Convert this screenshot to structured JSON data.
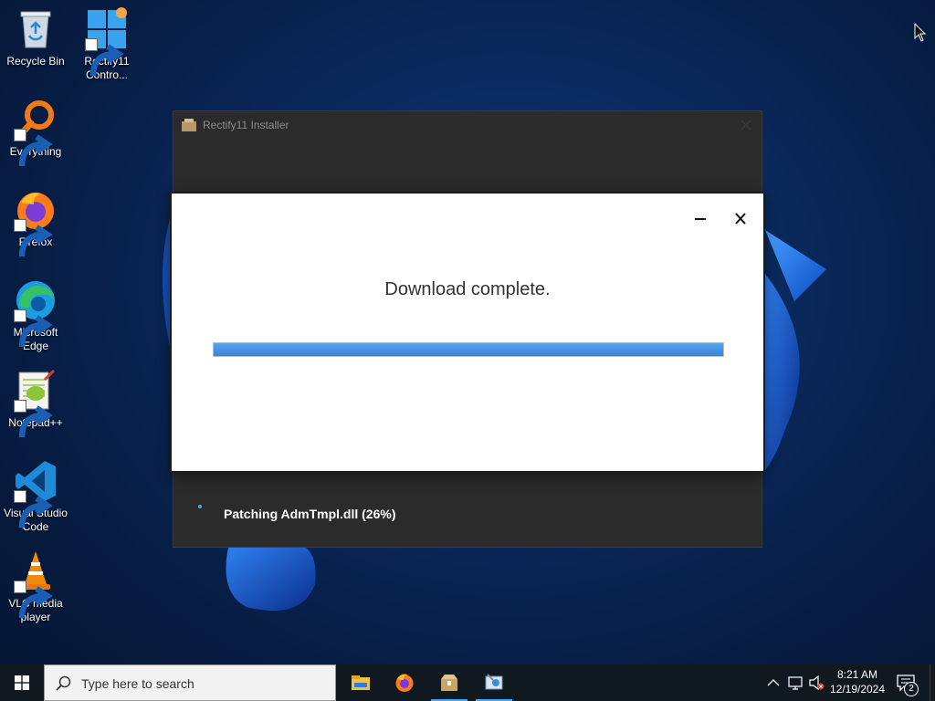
{
  "desktop": {
    "icons": [
      {
        "label": "Recycle Bin",
        "icon": "recycle-bin-icon"
      },
      {
        "label": "Rectify11\nContro...",
        "icon": "windows-control-icon"
      },
      {
        "label": "Everything",
        "icon": "magnifier-orange-icon"
      },
      {
        "label": "Firefox",
        "icon": "firefox-icon"
      },
      {
        "label": "Microsoft\nEdge",
        "icon": "edge-icon"
      },
      {
        "label": "Notepad++",
        "icon": "notepadpp-icon"
      },
      {
        "label": "Visual Studio\nCode",
        "icon": "vscode-icon"
      },
      {
        "label": "VLC media\nplayer",
        "icon": "vlc-cone-icon"
      }
    ]
  },
  "installer": {
    "title": "Rectify11 Installer",
    "status": "Patching AdmTmpl.dll (26%)"
  },
  "dialog": {
    "message": "Download complete.",
    "progress": 1.0,
    "colors": {
      "progress": "#3584db"
    }
  },
  "taskbar": {
    "search_placeholder": "Type here to search",
    "apps": [
      "file-explorer-icon",
      "firefox-icon",
      "installer-package-icon",
      "control-panel-icon"
    ],
    "time": "8:21 AM",
    "date": "12/19/2024",
    "notification_count": "2"
  }
}
